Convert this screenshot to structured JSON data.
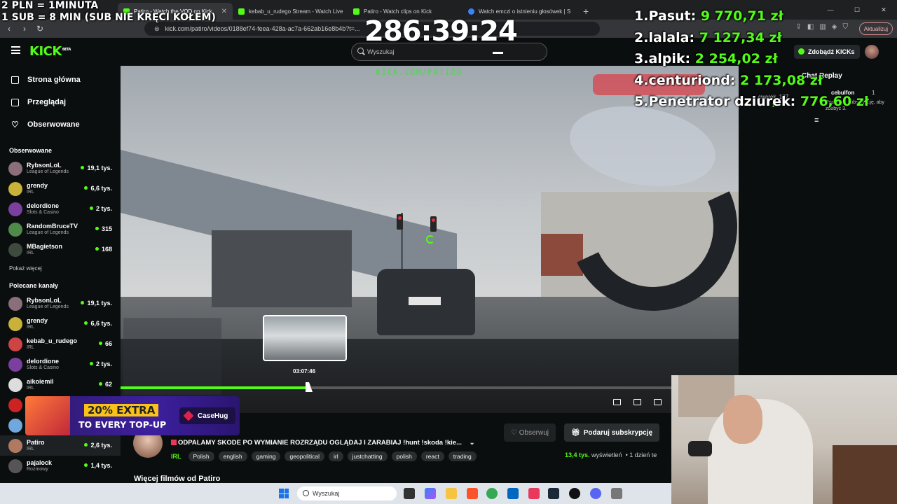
{
  "browser": {
    "tabs": [
      {
        "title": "Patiro - Watch the VOD on Kick",
        "active": true
      },
      {
        "title": "kebab_u_rudego Stream - Watch Live",
        "active": false
      },
      {
        "title": "Patiro - Watch clips on Kick",
        "active": false
      },
      {
        "title": "Watch emczi o istnieniu głosówek | S",
        "active": false
      }
    ],
    "new_tab": "+",
    "url": "kick.com/patiro/videos/0188ef74-feea-428a-ac7a-662ab16e8b4b?t=...",
    "update_button": "Aktualizuj"
  },
  "kick": {
    "logo": "KICK",
    "logo_sup": "BETA",
    "search_placeholder": "Wyszukaj",
    "get_kicks": "Zdobądź KICKs"
  },
  "sidebar": {
    "nav": [
      {
        "label": "Strona główna",
        "icon": "home-icon"
      },
      {
        "label": "Przeglądaj",
        "icon": "browse-icon"
      },
      {
        "label": "Obserwowane",
        "icon": "heart-icon"
      }
    ],
    "followed_title": "Obserwowane",
    "followed": [
      {
        "name": "RybsonLoL",
        "category": "League of Legends",
        "viewers": "19,1 tys.",
        "color": "#8a6f7a"
      },
      {
        "name": "grendy",
        "category": "IRL",
        "viewers": "6,6 tys.",
        "color": "#c9b23a"
      },
      {
        "name": "delordione",
        "category": "Slots & Casino",
        "viewers": "2 tys.",
        "color": "#7b3fa0"
      },
      {
        "name": "RandomBruceTV",
        "category": "League of Legends",
        "viewers": "315",
        "color": "#4f8a4a"
      },
      {
        "name": "MBagietson",
        "category": "IRL",
        "viewers": "168",
        "color": "#3d4a3d"
      }
    ],
    "show_more": "Pokaż więcej",
    "recommended_title": "Polecane kanały",
    "recommended": [
      {
        "name": "RybsonLoL",
        "category": "League of Legends",
        "viewers": "19,1 tys.",
        "color": "#8a6f7a"
      },
      {
        "name": "grendy",
        "category": "IRL",
        "viewers": "6,6 tys.",
        "color": "#c9b23a"
      },
      {
        "name": "kebab_u_rudego",
        "category": "IRL",
        "viewers": "66",
        "color": "#c44"
      },
      {
        "name": "delordione",
        "category": "Slots & Casino",
        "viewers": "2 tys.",
        "color": "#7b3fa0"
      },
      {
        "name": "aikoiemil",
        "category": "IRL",
        "viewers": "62",
        "color": "#ddd"
      },
      {
        "name": "",
        "category": "",
        "viewers": "",
        "color": "#c22"
      },
      {
        "name": "",
        "category": "",
        "viewers": "",
        "color": "#6fa8dc"
      },
      {
        "name": "Patiro",
        "category": "IRL",
        "viewers": "2,6 tys.",
        "color": "#b07a60"
      },
      {
        "name": "pajalock",
        "category": "Rozmowy",
        "viewers": "1,4 tys.",
        "color": "#555"
      }
    ]
  },
  "video": {
    "watermark": "KICK.COM/PATIRO",
    "hover_time": "03:07:46",
    "progress": 0.3
  },
  "stream": {
    "title": "ODPALAMY SKODE PO WYMIANIE ROZRZĄDU OGLĄDAJ I ZARABIAJ !hunt !skoda !kie...",
    "category": "IRL",
    "tags": [
      "Polish",
      "english",
      "gaming",
      "geopolitical",
      "irl",
      "justchatting",
      "polish",
      "react",
      "trading"
    ],
    "follow": "♡ Obserwuj",
    "subscribe": "Podaruj subskrypcję",
    "views": "13,4 tys.",
    "views_label": "wyświetleń",
    "age": "1 dzień te",
    "more_videos": "Więcej filmów od Patiro"
  },
  "chat": {
    "title": "Chat Replay",
    "line1_user": "cwarek_187",
    "line1_count": "1",
    "line2_user": "cebulfon",
    "line2_count": "1",
    "line2_text": "Podaruj 1 subskrypcję, aby zdobyć 3."
  },
  "overlay": {
    "line1": "2 PLN = 1MINUTA",
    "line2": "1 SUB = 8 MIN (SUB NIE KRĘCI KOŁEM)",
    "timer": "286:39:24",
    "leaderboard": [
      {
        "rank": "1.",
        "name": "Pasut:",
        "amount": "9 770,71 zł"
      },
      {
        "rank": "2.",
        "name": "lalala:",
        "amount": "7 127,34 zł"
      },
      {
        "rank": "3.",
        "name": "alpik:",
        "amount": "2 254,02 zł"
      },
      {
        "rank": "4.",
        "name": "centuriond:",
        "amount": "2 173,08 zł"
      },
      {
        "rank": "5.",
        "name": "Penetrator dziurek:",
        "amount": "776,60 zł"
      }
    ]
  },
  "ad": {
    "line1": "20% EXTRA",
    "line2": "TO EVERY TOP-UP",
    "brand": "CaseHug"
  },
  "taskbar": {
    "search_placeholder": "Wyszukaj"
  }
}
